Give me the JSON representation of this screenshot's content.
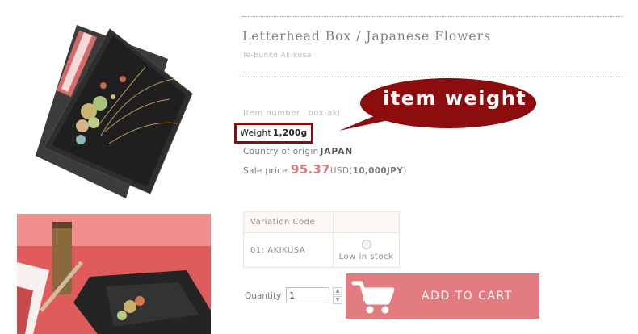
{
  "product": {
    "title": "Letterhead Box / Japanese Flowers",
    "subtitle": "Te-bunko Akikusa"
  },
  "details": {
    "item_number_label": "Item number",
    "item_number_value": "box-aki",
    "weight_label": "Weight",
    "weight_value": "1,200g",
    "origin_label": "Country of origin",
    "origin_value": "JAPAN",
    "sale_label": "Sale price",
    "sale_price": "95.37",
    "currency": "USD",
    "yen_prefix": "(",
    "yen_value": "10,000JPY",
    "yen_suffix": ")"
  },
  "callout": {
    "text": "item weight",
    "color": "#8b0d0d"
  },
  "variation": {
    "header": "Variation Code",
    "rows": [
      {
        "code": "01: AKIKUSA",
        "stock": "Low in stock"
      }
    ]
  },
  "purchase": {
    "quantity_label": "Quantity",
    "quantity_value": "1",
    "add_to_cart": "ADD TO CART",
    "button_color": "#e27c80"
  },
  "icons": [
    "cart-icon",
    "stepper-up-icon",
    "stepper-down-icon"
  ]
}
